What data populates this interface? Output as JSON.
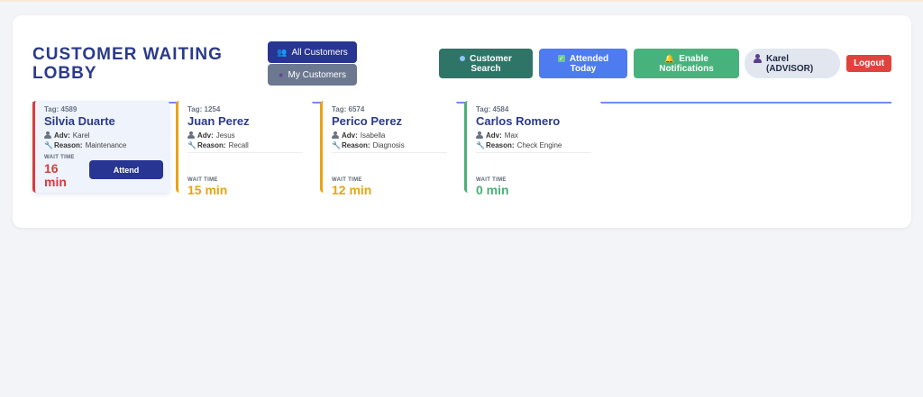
{
  "header": {
    "title": "CUSTOMER WAITING LOBBY"
  },
  "filters": {
    "all_label": "All Customers",
    "my_label": "My Customers"
  },
  "actions": {
    "search_label_1": "Customer",
    "search_label_2": "Search",
    "attended_label_1": "Attended",
    "attended_label_2": "Today",
    "notif_label_1": "Enable",
    "notif_label_2": "Notifications"
  },
  "user": {
    "name": "Karel",
    "role": "(ADVISOR)",
    "logout_label": "Logout"
  },
  "labels": {
    "adv": "Adv:",
    "reason": "Reason:",
    "wait_time": "WAIT TIME",
    "attend": "Attend"
  },
  "customers": [
    {
      "tag": "Tag: 4589",
      "name": "Silvia Duarte",
      "adv": "Karel",
      "reason": "Maintenance",
      "wait_num": "16",
      "wait_unit": "min",
      "color": "#d93b3b"
    },
    {
      "tag": "Tag: 1254",
      "name": "Juan Perez",
      "adv": "Jesus",
      "reason": "Recall",
      "wait": "15 min",
      "color": "#e8a317"
    },
    {
      "tag": "Tag: 6574",
      "name": "Perico Perez",
      "adv": "Isabella",
      "reason": "Diagnosis",
      "wait": "12 min",
      "color": "#e8a317"
    },
    {
      "tag": "Tag: 4584",
      "name": "Carlos Romero",
      "adv": "Max",
      "reason": "Check Engine",
      "wait": "0 min",
      "color": "#4caf78"
    }
  ]
}
